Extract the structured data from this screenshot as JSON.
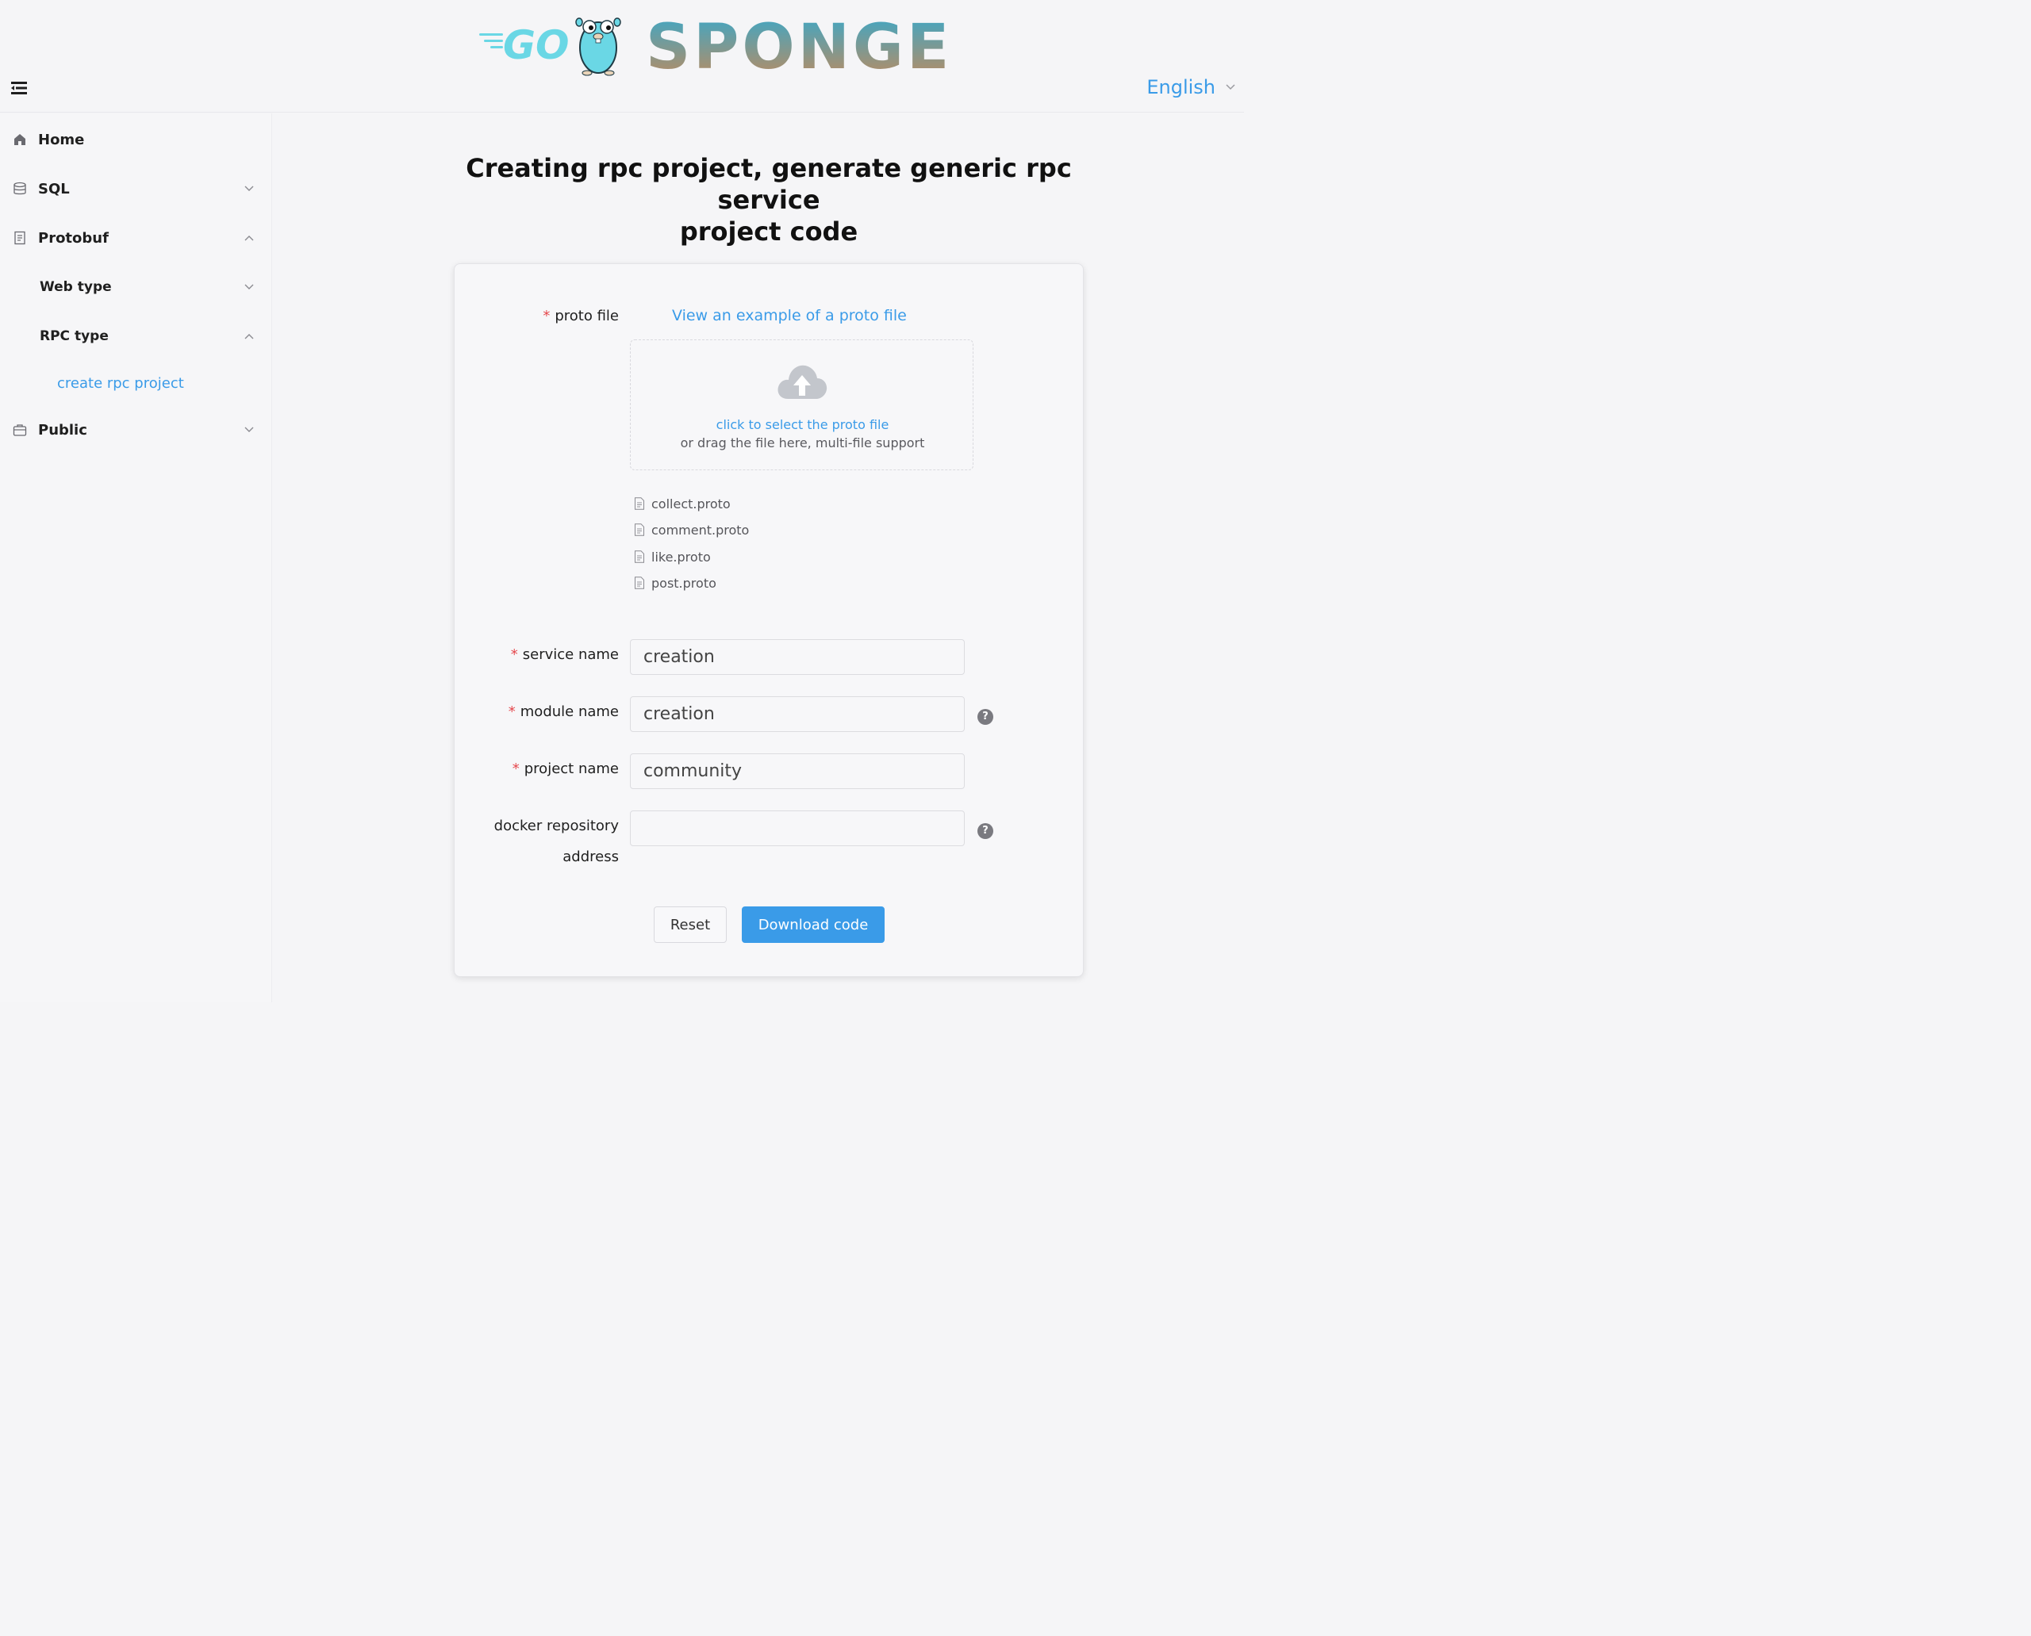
{
  "header": {
    "logo_go_text": "GO",
    "logo_brand_text": "SPONGE",
    "language": "English"
  },
  "sidebar": {
    "items": [
      {
        "label": "Home",
        "icon": "home-icon"
      },
      {
        "label": "SQL",
        "icon": "database-icon",
        "expanded": false
      },
      {
        "label": "Protobuf",
        "icon": "document-icon",
        "expanded": true
      },
      {
        "label": "Web type",
        "expanded": false
      },
      {
        "label": "RPC type",
        "expanded": true
      },
      {
        "label": "create rpc project",
        "active": true
      },
      {
        "label": "Public",
        "icon": "briefcase-icon",
        "expanded": false
      }
    ]
  },
  "main": {
    "title_line1": "Creating rpc project, generate generic rpc service",
    "title_line2": "project code"
  },
  "form": {
    "proto_label": "proto file",
    "example_link": "View an example of a proto file",
    "upload_hint": "click to select the proto file",
    "upload_sub": "or drag the file here, multi-file support",
    "files": [
      "collect.proto",
      "comment.proto",
      "like.proto",
      "post.proto"
    ],
    "service_label": "service name",
    "service_value": "creation",
    "module_label": "module name",
    "module_value": "creation",
    "project_label": "project name",
    "project_value": "community",
    "docker_label_line1": "docker repository",
    "docker_label_line2": "address",
    "docker_value": "",
    "reset_label": "Reset",
    "download_label": "Download code"
  },
  "colors": {
    "accent": "#3a9be8",
    "required": "#e5484d",
    "gopher": "#6ad7e5"
  }
}
